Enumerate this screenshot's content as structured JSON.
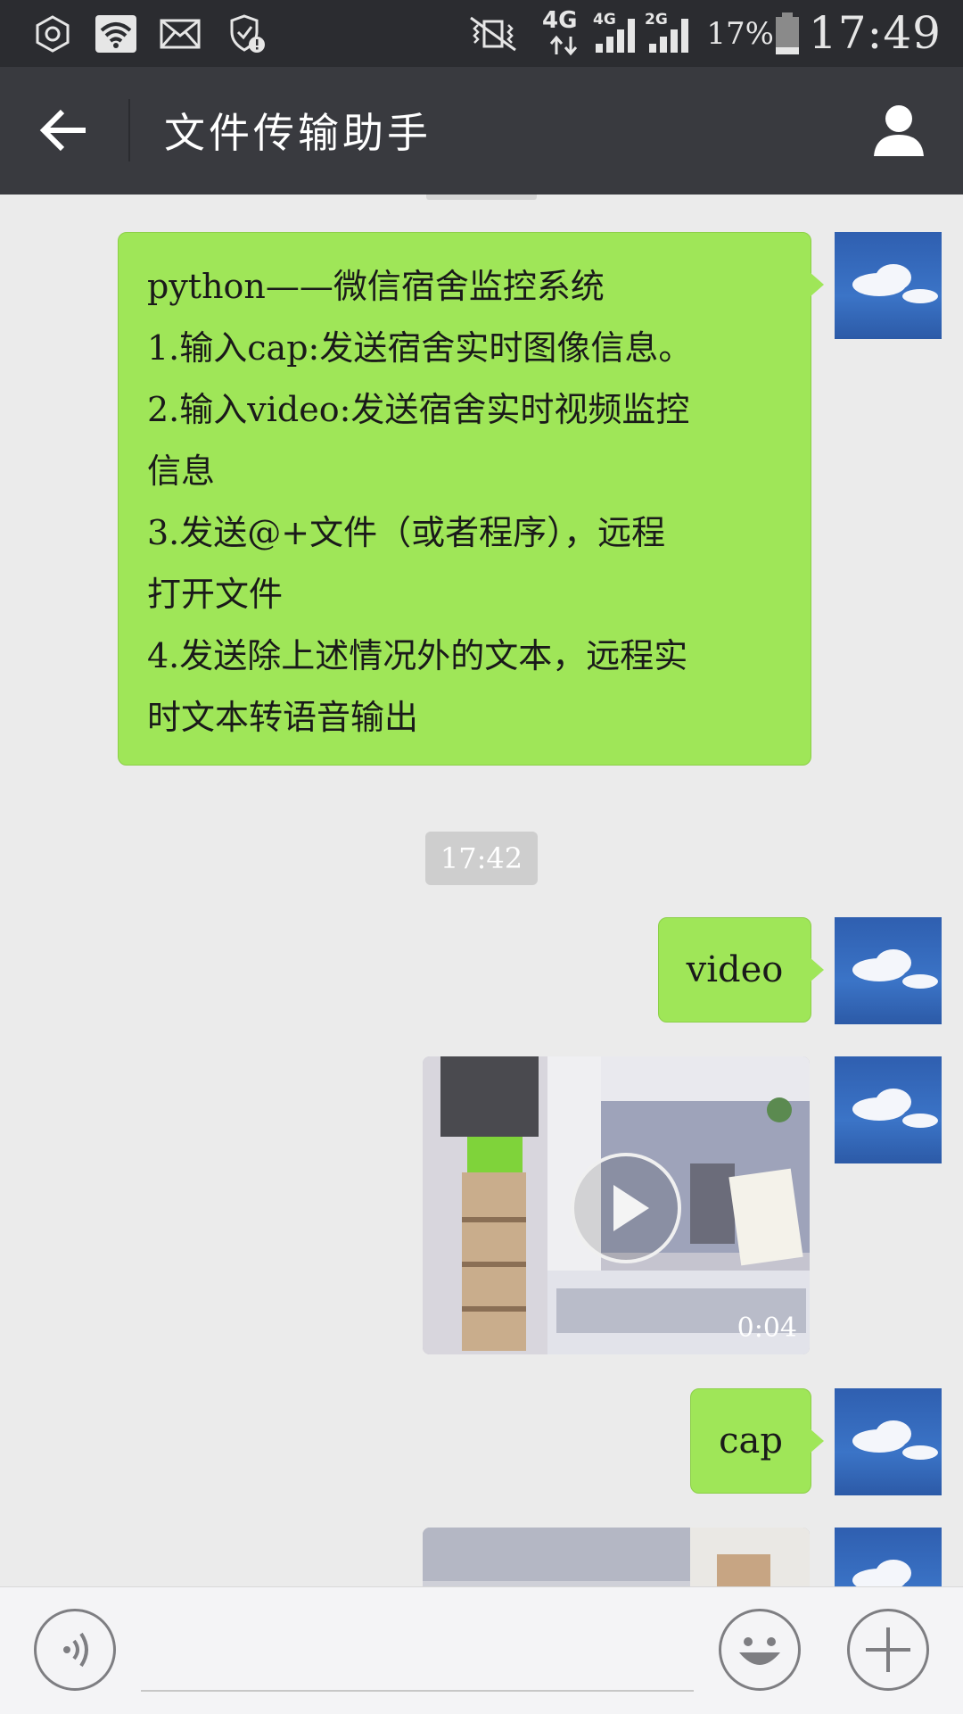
{
  "status_bar": {
    "network_top": "4G",
    "sim1_label": "4G",
    "sim2_label": "2G",
    "battery_percent": "17%",
    "time": "17:49"
  },
  "header": {
    "title": "文件传输助手"
  },
  "messages": {
    "m1": {
      "lines": [
        "python——微信宿舍监控系统",
        "1.输入cap:发送宿舍实时图像信息。",
        "2.输入video:发送宿舍实时视频监控",
        "信息",
        "3.发送@+文件（或者程序），远程",
        "打开文件",
        "4.发送除上述情况外的文本，远程实",
        "时文本转语音输出"
      ]
    },
    "timestamp": "17:42",
    "m2": {
      "text": "video"
    },
    "m3": {
      "duration": "0:04"
    },
    "m4": {
      "text": "cap"
    }
  },
  "colors": {
    "bubble": "#9fe658",
    "title_bar": "#393a3f",
    "status_bar": "#2b2c30",
    "chat_bg": "#ebebeb"
  },
  "icons": {
    "back": "arrow-left-icon",
    "profile": "person-icon",
    "voice": "voice-icon",
    "emoji": "emoji-icon",
    "plus": "plus-icon",
    "play": "play-icon"
  }
}
